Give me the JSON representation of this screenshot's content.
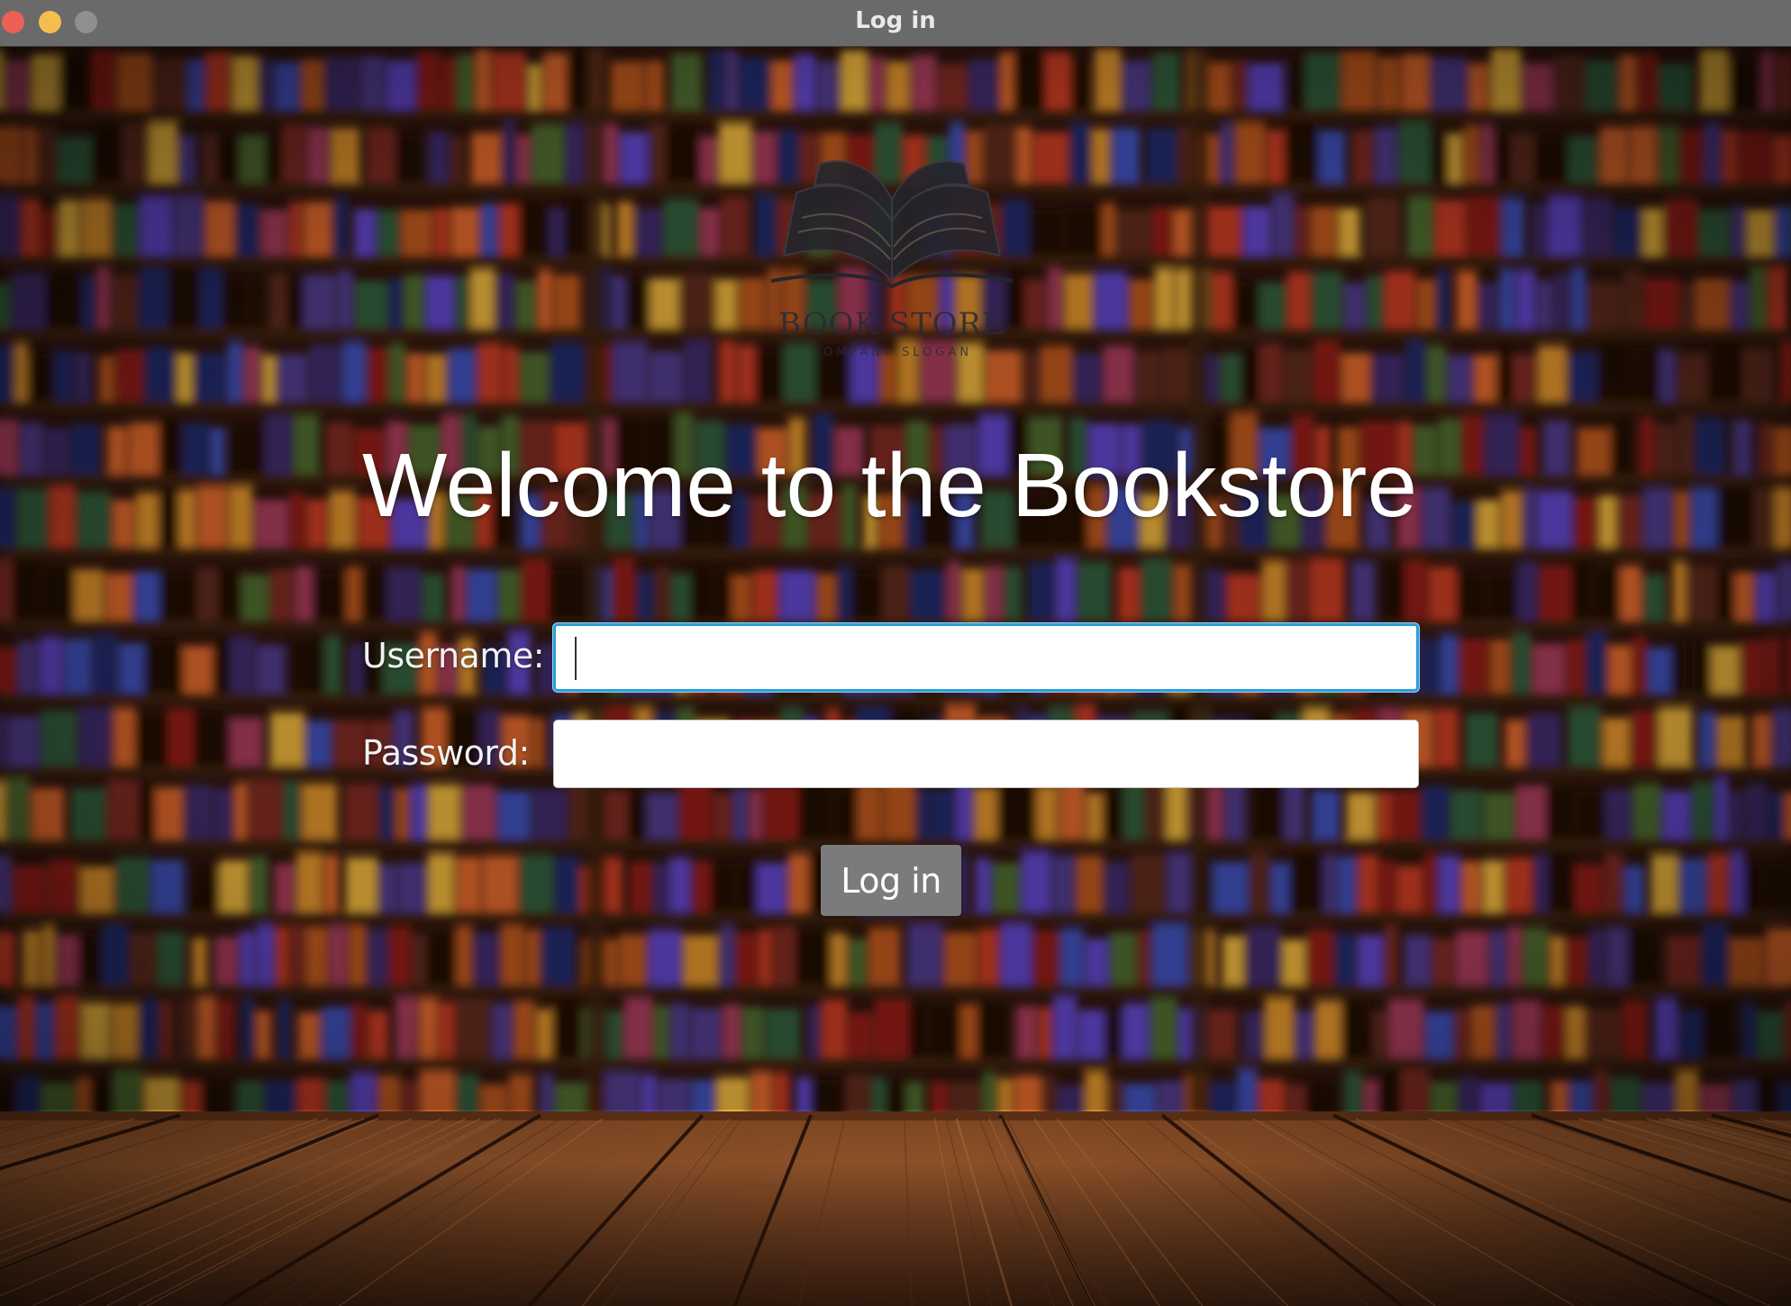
{
  "window": {
    "title": "Log in"
  },
  "logo": {
    "title": "BOOK STORE",
    "slogan": "COMPANY SLOGAN"
  },
  "main": {
    "heading": "Welcome to the Bookstore"
  },
  "form": {
    "username_label": "Username:",
    "username_value": "",
    "password_label": "Password:",
    "password_value": "",
    "submit_label": "Log in"
  },
  "colors": {
    "focus_ring": "#2b9edb",
    "button_bg": "#7b7b7b",
    "titlebar_bg": "#6a6a6a",
    "close": "#ec5f57",
    "minimize": "#f4be4f",
    "maximize": "#8f8f8f"
  },
  "icons": {
    "window_close": "close-circle",
    "window_minimize": "minimize-circle",
    "window_maximize": "maximize-circle",
    "logo": "open-book-icon"
  }
}
